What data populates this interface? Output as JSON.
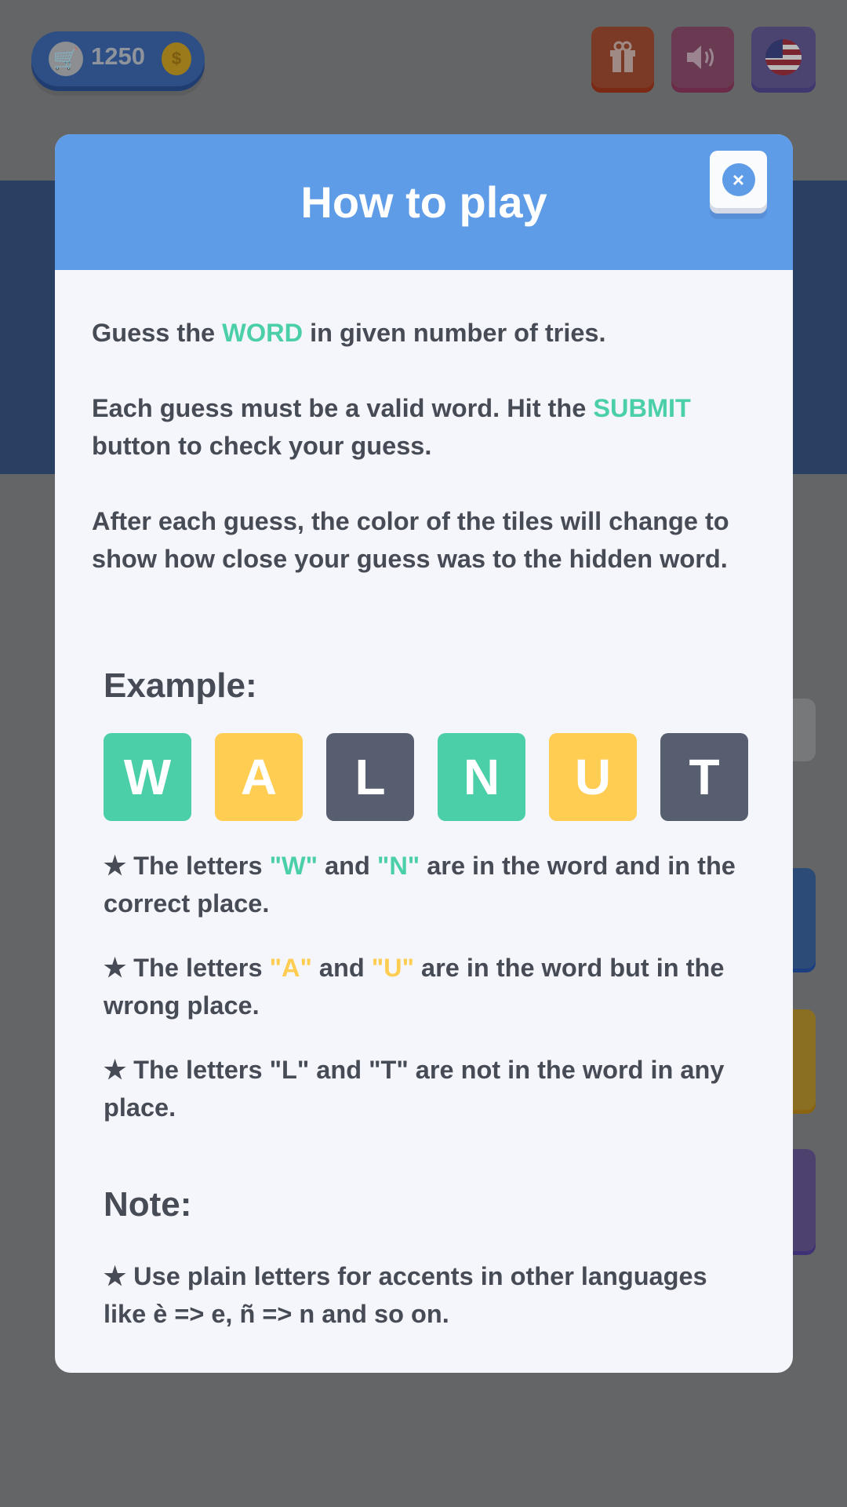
{
  "topbar": {
    "coins": "1250",
    "cart_icon": "🛒",
    "coin_icon": "$"
  },
  "modal": {
    "title": "How to play",
    "close_icon": "×",
    "intro": [
      [
        {
          "t": "Guess the ",
          "c": ""
        },
        {
          "t": "WORD",
          "c": "g"
        },
        {
          "t": " in given number of tries.",
          "c": ""
        }
      ],
      [
        {
          "t": "Each guess must be a valid word. Hit the ",
          "c": ""
        },
        {
          "t": "SUBMIT",
          "c": "g"
        },
        {
          "t": " button to check your guess.",
          "c": ""
        }
      ],
      [
        {
          "t": "After each guess, the color of the tiles will change to show how close your guess was to the hidden word.",
          "c": ""
        }
      ]
    ],
    "example_heading": "Example:",
    "tiles": [
      {
        "letter": "W",
        "color": "#4acfa9"
      },
      {
        "letter": "A",
        "color": "#ffcd51"
      },
      {
        "letter": "L",
        "color": "#575e70"
      },
      {
        "letter": "N",
        "color": "#4acfa9"
      },
      {
        "letter": "U",
        "color": "#ffcd51"
      },
      {
        "letter": "T",
        "color": "#575e70"
      }
    ],
    "bullets": [
      [
        {
          "t": "★ The letters ",
          "c": ""
        },
        {
          "t": "\"W\"",
          "c": "g"
        },
        {
          "t": " and ",
          "c": ""
        },
        {
          "t": "\"N\"",
          "c": "g"
        },
        {
          "t": " are in the word and in the correct place.",
          "c": ""
        }
      ],
      [
        {
          "t": "★ The letters ",
          "c": ""
        },
        {
          "t": "\"A\"",
          "c": "y"
        },
        {
          "t": " and ",
          "c": ""
        },
        {
          "t": "\"U\"",
          "c": "y"
        },
        {
          "t": " are in the word but in the wrong place.",
          "c": ""
        }
      ],
      [
        {
          "t": "★ The letters ",
          "c": ""
        },
        {
          "t": "\"L\"",
          "c": ""
        },
        {
          "t": " and ",
          "c": ""
        },
        {
          "t": "\"T\"",
          "c": ""
        },
        {
          "t": " are not in the word in any place.",
          "c": ""
        }
      ]
    ],
    "note_heading": "Note:",
    "note": "★ Use plain letters for accents in other languages like è => e, ñ => n and so on."
  },
  "colors": {
    "correct": "#4acfa9",
    "present": "#ffcd51",
    "absent": "#575e70",
    "header": "#5f9ce8"
  }
}
